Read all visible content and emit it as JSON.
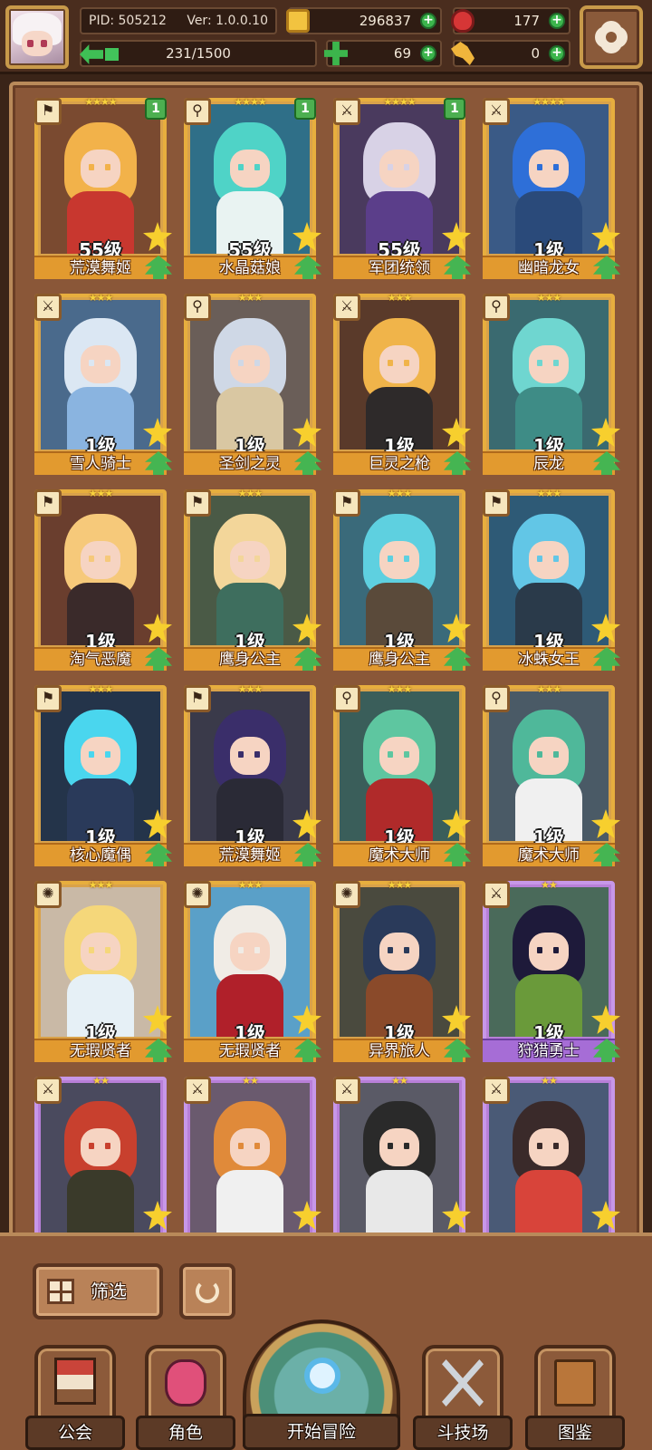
{
  "header": {
    "pid": "PID: 505212",
    "version": "Ver: 1.0.0.10",
    "exp": "231/1500",
    "exp_progress": 0.154,
    "gold": "296837",
    "gems": "177",
    "clover": "69",
    "keys": "0",
    "plus": "+"
  },
  "cards": [
    {
      "name": "荒漠舞姬",
      "level": "55级",
      "stars": "★★★★",
      "badge": "1",
      "class_icon": "⚑",
      "frame": "gold",
      "hair": "#f2b24a",
      "body": "#c8372f",
      "bg": "#7a4a30"
    },
    {
      "name": "水晶菇娘",
      "level": "55级",
      "stars": "★★★★",
      "badge": "1",
      "class_icon": "⚲",
      "frame": "gold",
      "hair": "#4fd3c7",
      "body": "#e9f3f2",
      "bg": "#2f6f88"
    },
    {
      "name": "军团统领",
      "level": "55级",
      "stars": "★★★★",
      "badge": "1",
      "class_icon": "⚔",
      "frame": "gold",
      "hair": "#d8d2e6",
      "body": "#5b3e8a",
      "bg": "#4a3a5e"
    },
    {
      "name": "幽暗龙女",
      "level": "1级",
      "stars": "★★★★",
      "badge": "",
      "class_icon": "⚔",
      "frame": "gold",
      "hair": "#2e6fd8",
      "body": "#2a4a7a",
      "bg": "#3a5a86"
    },
    {
      "name": "雪人骑士",
      "level": "1级",
      "stars": "★★★",
      "badge": "",
      "class_icon": "⚔",
      "frame": "gold",
      "hair": "#dbe7f3",
      "body": "#8ab4e0",
      "bg": "#4a6a8c"
    },
    {
      "name": "圣剑之灵",
      "level": "1级",
      "stars": "★★★",
      "badge": "",
      "class_icon": "⚲",
      "frame": "gold",
      "hair": "#cfd8e6",
      "body": "#d9c7a2",
      "bg": "#6a5e58"
    },
    {
      "name": "巨灵之枪",
      "level": "1级",
      "stars": "★★★",
      "badge": "",
      "class_icon": "⚔",
      "frame": "gold",
      "hair": "#f0b44a",
      "body": "#2e2a2a",
      "bg": "#5a3a2a"
    },
    {
      "name": "辰龙",
      "level": "1级",
      "stars": "★★★",
      "badge": "",
      "class_icon": "⚲",
      "frame": "gold",
      "hair": "#6fd6d0",
      "body": "#3e8c86",
      "bg": "#3a6a70"
    },
    {
      "name": "淘气恶魔",
      "level": "1级",
      "stars": "★★★",
      "badge": "",
      "class_icon": "⚑",
      "frame": "gold",
      "hair": "#f6c97a",
      "body": "#3a2a2a",
      "bg": "#6a3e2e"
    },
    {
      "name": "鹰身公主",
      "level": "1级",
      "stars": "★★★",
      "badge": "",
      "class_icon": "⚑",
      "frame": "gold",
      "hair": "#f3d69a",
      "body": "#3e6e5e",
      "bg": "#4a5a46"
    },
    {
      "name": "鹰身公主",
      "level": "1级",
      "stars": "★★★",
      "badge": "",
      "class_icon": "⚑",
      "frame": "gold",
      "hair": "#5ed0e0",
      "body": "#5a4a3a",
      "bg": "#3a6a7a"
    },
    {
      "name": "冰蛛女王",
      "level": "1级",
      "stars": "★★★",
      "badge": "",
      "class_icon": "⚑",
      "frame": "gold",
      "hair": "#62c6e6",
      "body": "#2a3a4a",
      "bg": "#2e5a76"
    },
    {
      "name": "核心魔偶",
      "level": "1级",
      "stars": "★★★",
      "badge": "",
      "class_icon": "⚑",
      "frame": "gold",
      "hair": "#4ad6ee",
      "body": "#2a3a5a",
      "bg": "#24344a"
    },
    {
      "name": "荒漠舞姬",
      "level": "1级",
      "stars": "★★★",
      "badge": "",
      "class_icon": "⚑",
      "frame": "gold",
      "hair": "#3a2e6a",
      "body": "#2a2a36",
      "bg": "#3a3a4a"
    },
    {
      "name": "魔术大师",
      "level": "1级",
      "stars": "★★★",
      "badge": "",
      "class_icon": "⚲",
      "frame": "gold",
      "hair": "#5ec6a0",
      "body": "#b02a2a",
      "bg": "#3a5e5a"
    },
    {
      "name": "魔术大师",
      "level": "1级",
      "stars": "★★★",
      "badge": "",
      "class_icon": "⚲",
      "frame": "gold",
      "hair": "#4fb89a",
      "body": "#f0f0f0",
      "bg": "#4a5a66"
    },
    {
      "name": "无瑕贤者",
      "level": "1级",
      "stars": "★★★",
      "badge": "",
      "class_icon": "✺",
      "frame": "gold",
      "hair": "#f5d77a",
      "body": "#e6f0f6",
      "bg": "#c9b9a6"
    },
    {
      "name": "无瑕贤者",
      "level": "1级",
      "stars": "★★★",
      "badge": "",
      "class_icon": "✺",
      "frame": "gold",
      "hair": "#f0ece6",
      "body": "#b0202a",
      "bg": "#5aa0c8"
    },
    {
      "name": "异界旅人",
      "level": "1级",
      "stars": "★★★",
      "badge": "",
      "class_icon": "✺",
      "frame": "gold",
      "hair": "#2a3a5a",
      "body": "#8a4a2a",
      "bg": "#4a4a3e"
    },
    {
      "name": "狩猎勇士",
      "level": "1级",
      "stars": "★★",
      "badge": "",
      "class_icon": "⚔",
      "frame": "purple",
      "hair": "#1e1a3a",
      "body": "#6a9a3a",
      "bg": "#4a6a5a"
    },
    {
      "name": "",
      "level": "",
      "stars": "★★",
      "badge": "",
      "class_icon": "⚔",
      "frame": "purple",
      "hair": "#c8402e",
      "body": "#3a3a2a",
      "bg": "#4a4a5e"
    },
    {
      "name": "",
      "level": "",
      "stars": "★★",
      "badge": "",
      "class_icon": "⚔",
      "frame": "purple",
      "hair": "#e08a3a",
      "body": "#f0f0f0",
      "bg": "#6a5a6e"
    },
    {
      "name": "",
      "level": "",
      "stars": "★★",
      "badge": "",
      "class_icon": "⚔",
      "frame": "purple",
      "hair": "#2a2a2a",
      "body": "#e8e8e8",
      "bg": "#5a5a66"
    },
    {
      "name": "",
      "level": "",
      "stars": "★★",
      "badge": "",
      "class_icon": "⚔",
      "frame": "purple",
      "hair": "#3a2a2a",
      "body": "#d8443a",
      "bg": "#4a5a76"
    }
  ],
  "controls": {
    "filter_label": "筛选"
  },
  "nav": {
    "guild": "公会",
    "role": "角色",
    "adventure": "开始冒险",
    "arena": "斗技场",
    "codex": "图鉴"
  }
}
